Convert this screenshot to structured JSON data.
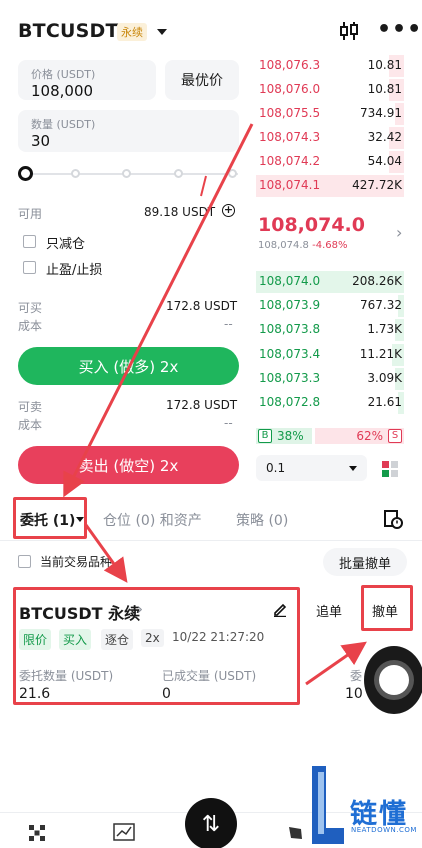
{
  "header": {
    "symbol": "BTCUSDT",
    "contract_tag": "永续",
    "chart_icon": "candlestick-icon",
    "more_icon": "more-dots-icon"
  },
  "form": {
    "price_label": "价格 (USDT)",
    "price_value": "108,000",
    "best_price_label": "最优价",
    "qty_label": "数量 (USDT)",
    "qty_value": "30",
    "available_label": "可用",
    "available_value": "89.18 USDT",
    "reduce_only_label": "只减仓",
    "tpsl_label": "止盈/止损",
    "can_buy_label": "可买",
    "can_buy_value": "172.8 USDT",
    "buy_cost_label": "成本",
    "buy_cost_value": "--",
    "buy_button": "买入 (做多) 2x",
    "can_sell_label": "可卖",
    "can_sell_value": "172.8 USDT",
    "sell_cost_label": "成本",
    "sell_cost_value": "--",
    "sell_button": "卖出 (做空) 2x"
  },
  "orderbook": {
    "asks": [
      {
        "price": "108,076.3",
        "qty": "10.81",
        "depth": 0.1
      },
      {
        "price": "108,076.0",
        "qty": "10.81",
        "depth": 0.1
      },
      {
        "price": "108,075.5",
        "qty": "734.91",
        "depth": 0.06
      },
      {
        "price": "108,074.3",
        "qty": "32.42",
        "depth": 0.1
      },
      {
        "price": "108,074.2",
        "qty": "54.04",
        "depth": 0.1
      },
      {
        "price": "108,074.1",
        "qty": "427.72K",
        "depth": 1.0
      }
    ],
    "last_price": "108,074.0",
    "mark_price": "108,074.8",
    "change_pct": "-4.68%",
    "bids": [
      {
        "price": "108,074.0",
        "qty": "208.26K",
        "depth": 1.0
      },
      {
        "price": "108,073.9",
        "qty": "767.32",
        "depth": 0.04
      },
      {
        "price": "108,073.8",
        "qty": "1.73K",
        "depth": 0.06
      },
      {
        "price": "108,073.4",
        "qty": "11.21K",
        "depth": 0.08
      },
      {
        "price": "108,073.3",
        "qty": "3.09K",
        "depth": 0.06
      },
      {
        "price": "108,072.8",
        "qty": "21.61",
        "depth": 0.04
      }
    ],
    "buy_tag": "B",
    "buy_ratio": "38%",
    "sell_ratio": "62%",
    "sell_tag": "S",
    "buy_ratio_value": 0.38,
    "depth_step": "0.1",
    "colors": {
      "ask": "#e03a55",
      "bid": "#139a4a"
    }
  },
  "tabs": {
    "orders": "委托 (1)",
    "positions": "仓位 (0) 和资产",
    "strategy": "策略 (0)"
  },
  "orders_panel": {
    "current_only_label": "当前交易品种",
    "bulk_cancel": "批量撤单",
    "order": {
      "symbol": "BTCUSDT 永续",
      "type": "限价",
      "side": "买入",
      "margin_mode": "逐仓",
      "leverage": "2x",
      "time": "10/22 21:27:20",
      "qty_label": "委托数量 (USDT)",
      "qty_value": "21.6",
      "filled_label": "已成交量 (USDT)",
      "filled_value": "0",
      "right_label_partial": "委",
      "right_value_partial": "10"
    },
    "chase_button": "追单",
    "cancel_button": "撤单"
  },
  "bottom": {
    "swap_icon": "swap-arrows-icon"
  },
  "watermark": {
    "text": "链懂",
    "url": "NEATDOWN.COM"
  }
}
